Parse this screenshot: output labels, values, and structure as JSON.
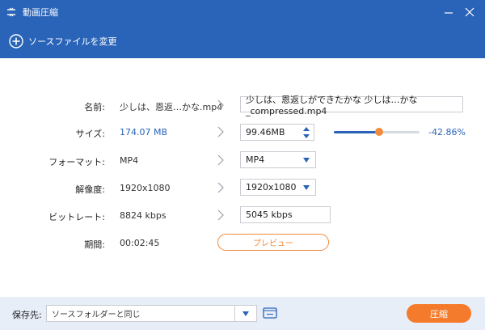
{
  "window": {
    "title": "動画圧縮"
  },
  "toolbar": {
    "add_source_label": "ソースファイルを変更"
  },
  "fields": {
    "name": {
      "label": "名前:",
      "source": "少しは、恩返…かな.mp4",
      "output": "少しは、恩返しができたかな 少しは…かな_compressed.mp4"
    },
    "size": {
      "label": "サイズ:",
      "source": "174.07 MB",
      "output": "99.46MB",
      "percent": "-42.86%",
      "slider_fraction": 0.53
    },
    "format": {
      "label": "フォーマット:",
      "source": "MP4",
      "output": "MP4"
    },
    "resolution": {
      "label": "解像度:",
      "source": "1920x1080",
      "output": "1920x1080"
    },
    "bitrate": {
      "label": "ビットレート:",
      "source": "8824 kbps",
      "output": "5045 kbps"
    },
    "duration": {
      "label": "期間:",
      "source": "00:02:45"
    }
  },
  "preview": {
    "label": "プレビュー"
  },
  "footer": {
    "save_to_label": "保存先:",
    "save_path": "ソースフォルダーと同じ",
    "compress_label": "圧縮"
  },
  "colors": {
    "accent": "#2a64b8",
    "orange": "#f47b2c",
    "footer_bg": "#e8eef8"
  },
  "icons": [
    "app-icon",
    "minimize-icon",
    "close-icon",
    "add-circle-icon",
    "chevron-right-icon",
    "spinner-arrows-icon",
    "dropdown-arrow-icon",
    "folder-icon"
  ]
}
